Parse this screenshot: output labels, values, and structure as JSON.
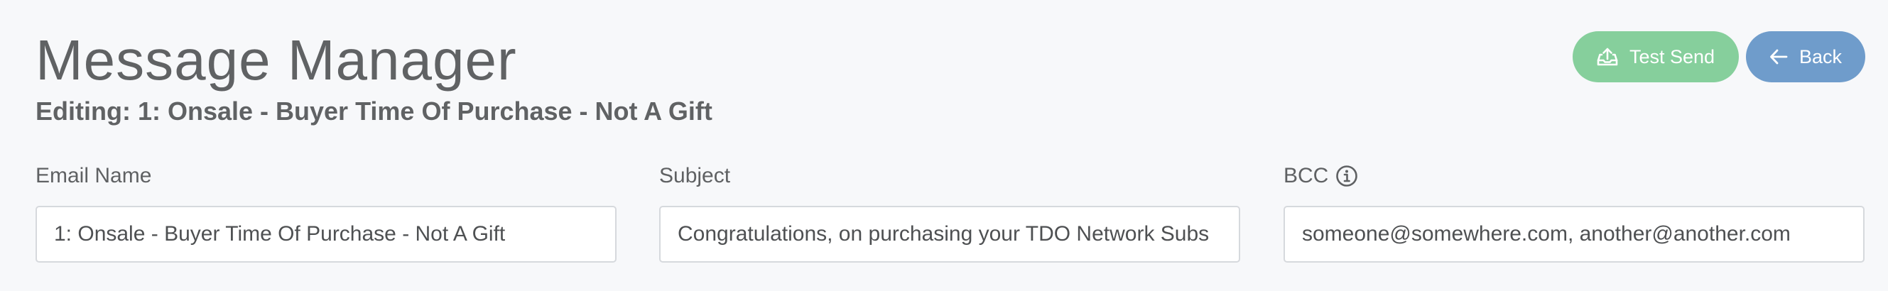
{
  "header": {
    "title": "Message Manager",
    "editing": "Editing: 1: Onsale - Buyer Time Of Purchase - Not A Gift"
  },
  "actions": {
    "test_send": {
      "label": "Test Send",
      "icon": "tray-upload-icon",
      "color": "#86cf9c"
    },
    "back": {
      "label": "Back",
      "icon": "arrow-left-icon",
      "color": "#6f9ccb"
    }
  },
  "form": {
    "email_name": {
      "label": "Email Name",
      "value": "1: Onsale - Buyer Time Of Purchase - Not A Gift"
    },
    "subject": {
      "label": "Subject",
      "value": "Congratulations, on purchasing your TDO Network Subs"
    },
    "bcc": {
      "label": "BCC",
      "icon": "info-icon",
      "value": "someone@somewhere.com, another@another.com"
    }
  }
}
